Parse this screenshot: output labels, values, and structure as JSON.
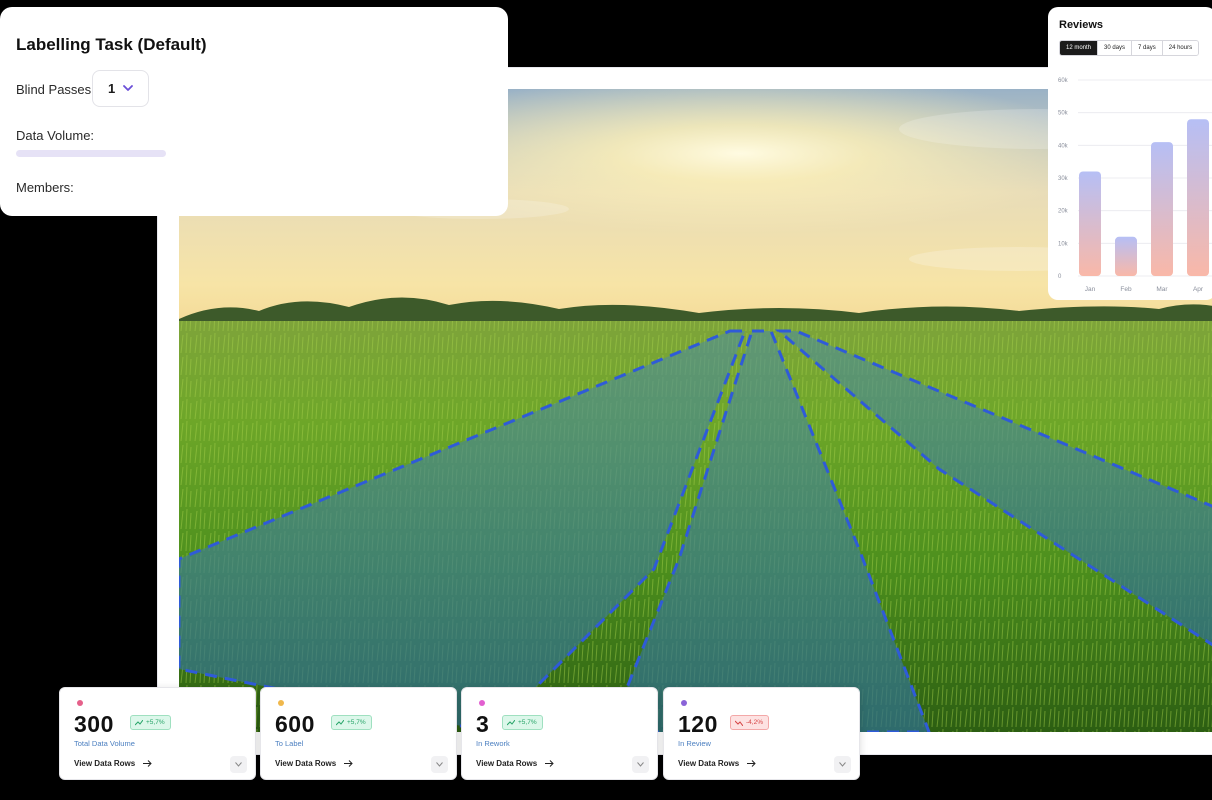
{
  "task_panel": {
    "title": "Labelling Task (Default)",
    "blind_passes_label": "Blind Passes",
    "blind_passes_value": "1",
    "data_volume_label": "Data Volume:",
    "members_label": "Members:"
  },
  "image": {
    "icon": "field-image",
    "annotation_color": "#2f5bd8"
  },
  "reviews": {
    "title": "Reviews",
    "ranges": [
      "12 month",
      "30 days",
      "7 days",
      "24 hours"
    ],
    "active_range": "12 month"
  },
  "chart_data": {
    "type": "bar",
    "title": "Reviews",
    "categories": [
      "Jan",
      "Feb",
      "Mar",
      "Apr"
    ],
    "values": [
      32000,
      12000,
      41000,
      48000
    ],
    "yticks": [
      "0",
      "10k",
      "20k",
      "30k",
      "40k",
      "50k",
      "60k"
    ],
    "ylim": [
      0,
      60000
    ],
    "grid": true,
    "gradient": [
      "#b6bff5",
      "#f9b8a8"
    ]
  },
  "stats": [
    {
      "value": "300",
      "label": "Total Data Volume",
      "change": "+5,7%",
      "trend": "up",
      "dot_color": "#e5608a",
      "link": "View Data Rows"
    },
    {
      "value": "600",
      "label": "To Label",
      "change": "+5,7%",
      "trend": "up",
      "dot_color": "#f0b84c",
      "link": "View Data Rows"
    },
    {
      "value": "3",
      "label": "In Rework",
      "change": "+5,7%",
      "trend": "up",
      "dot_color": "#e25fd0",
      "link": "View Data Rows"
    },
    {
      "value": "120",
      "label": "In Review",
      "change": "-4,2%",
      "trend": "down",
      "dot_color": "#8a63d8",
      "link": "View Data Rows"
    }
  ]
}
